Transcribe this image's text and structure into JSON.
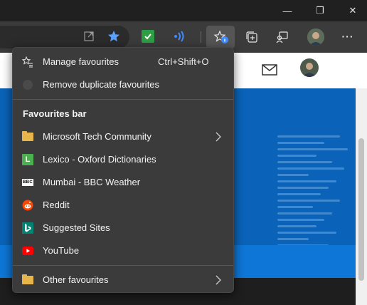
{
  "window": {
    "minimize": "—",
    "restore": "❐",
    "close": "✕"
  },
  "toolbar": {
    "icons": [
      "open-in-app-icon",
      "favorite-star-icon",
      "extension-check-icon",
      "read-aloud-icon",
      "favorites-icon",
      "collections-icon",
      "feedback-icon",
      "profile-avatar",
      "more-icon"
    ],
    "more_label": "···"
  },
  "menu": {
    "top_items": [
      {
        "label": "Manage favourites",
        "shortcut": "Ctrl+Shift+O",
        "icon": "manage-favourites-icon"
      },
      {
        "label": "Remove duplicate favourites",
        "icon": "remove-duplicates-icon"
      }
    ],
    "section_title": "Favourites bar",
    "items": [
      {
        "label": "Microsoft Tech Community",
        "icon": "folder-icon",
        "has_submenu": true
      },
      {
        "label": "Lexico - Oxford Dictionaries",
        "icon": "lexico-favicon",
        "favicon_text": "L",
        "favicon_color": "#4caf50"
      },
      {
        "label": "Mumbai - BBC Weather",
        "icon": "bbc-favicon",
        "favicon_text": "BBC"
      },
      {
        "label": "Reddit",
        "icon": "reddit-favicon",
        "favicon_color": "#ff4500"
      },
      {
        "label": "Suggested Sites",
        "icon": "bing-favicon",
        "favicon_color": "#008373"
      },
      {
        "label": "YouTube",
        "icon": "youtube-favicon",
        "favicon_color": "#ff0000"
      }
    ],
    "other": {
      "label": "Other favourites",
      "icon": "folder-icon",
      "has_submenu": true
    }
  },
  "colors": {
    "menu_bg": "#3b3b3b",
    "accent_blue": "#0a63b8",
    "folder": "#e8b54a"
  }
}
